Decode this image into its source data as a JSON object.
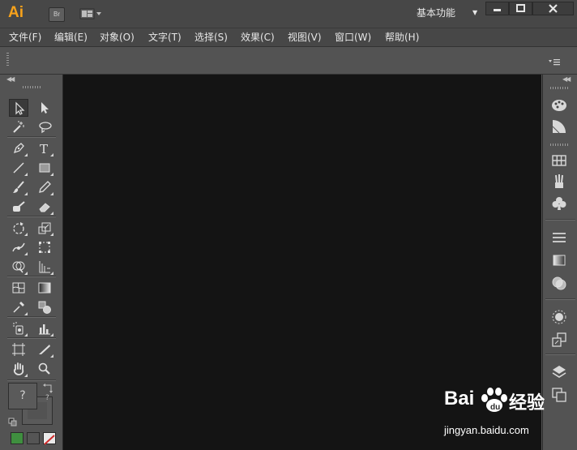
{
  "app": {
    "logo_text": "Ai",
    "bridge_label": "Br",
    "workspace_label": "基本功能"
  },
  "menu": {
    "items": [
      {
        "label": "文件(F)"
      },
      {
        "label": "编辑(E)"
      },
      {
        "label": "对象(O)"
      },
      {
        "label": "文字(T)"
      },
      {
        "label": "选择(S)"
      },
      {
        "label": "效果(C)"
      },
      {
        "label": "视图(V)"
      },
      {
        "label": "窗口(W)"
      },
      {
        "label": "帮助(H)"
      }
    ]
  },
  "tools": {
    "type_tool_glyph": "T",
    "fill_swatch_glyph": "?",
    "stroke_swatch_glyph": "?"
  },
  "colors": {
    "accent_logo": "#f7a21b",
    "chrome": "#535353",
    "canvas": "#141414"
  },
  "watermark": {
    "brand": "Bai",
    "brand_tail": "经验",
    "url": "jingyan.baidu.com"
  }
}
